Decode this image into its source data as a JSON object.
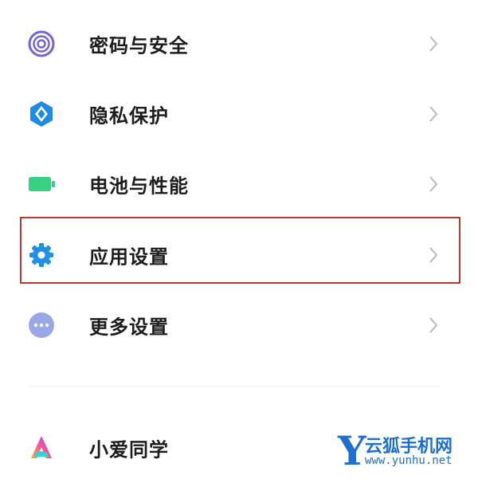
{
  "settings": {
    "items": [
      {
        "label": "密码与安全",
        "icon": "fingerprint-icon"
      },
      {
        "label": "隐私保护",
        "icon": "privacy-shield-icon"
      },
      {
        "label": "电池与性能",
        "icon": "battery-icon"
      },
      {
        "label": "应用设置",
        "icon": "gear-icon",
        "highlighted": true
      },
      {
        "label": "更多设置",
        "icon": "more-dots-icon"
      },
      {
        "label": "小爱同学",
        "icon": "xiaoai-assistant-icon"
      }
    ],
    "chevron": "chevron-right-icon"
  },
  "watermark": {
    "letter": "Y",
    "name": "云狐手机网",
    "url": "www.yunhu.net"
  },
  "colors": {
    "highlight_border": "#b63a32",
    "gear": "#1f8fe8",
    "battery": "#3ad082",
    "privacy": "#1d8be6",
    "fingerprint": "#7166d6",
    "more": "#9aa7e6",
    "watermark": "#1f6fd1"
  }
}
